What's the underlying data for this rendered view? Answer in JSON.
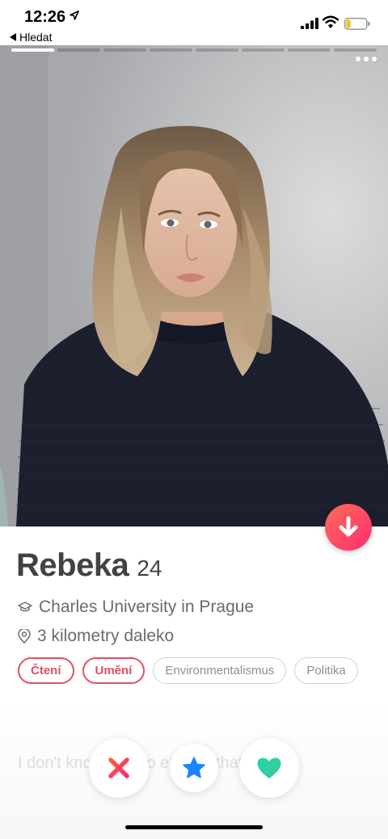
{
  "status_bar": {
    "time": "12:26",
    "back_label": "Hledat"
  },
  "photo": {
    "total_photos": 8,
    "current_photo": 1
  },
  "profile": {
    "name": "Rebeka",
    "age": "24",
    "school": "Charles University in Prague",
    "distance": "3 kilometry daleko",
    "interests": [
      {
        "label": "Čtení",
        "shared": true
      },
      {
        "label": "Umění",
        "shared": true
      },
      {
        "label": "Environmentalismus",
        "shared": false
      },
      {
        "label": "Politika",
        "shared": false
      }
    ],
    "bio_preview": "I don't know how to explain that you"
  },
  "icons": {
    "back": "back-arrow-icon",
    "school": "graduation-cap-icon",
    "distance": "location-pin-icon",
    "more": "more-dots-icon",
    "down": "arrow-down-icon",
    "nope": "close-x-icon",
    "super_like": "star-icon",
    "like": "heart-icon"
  },
  "colors": {
    "accent": "#fe3c72",
    "shared_chip": "#e24f62",
    "nope": "#fd267d",
    "super_like": "#1786ff",
    "like": "#2ed3a3"
  }
}
